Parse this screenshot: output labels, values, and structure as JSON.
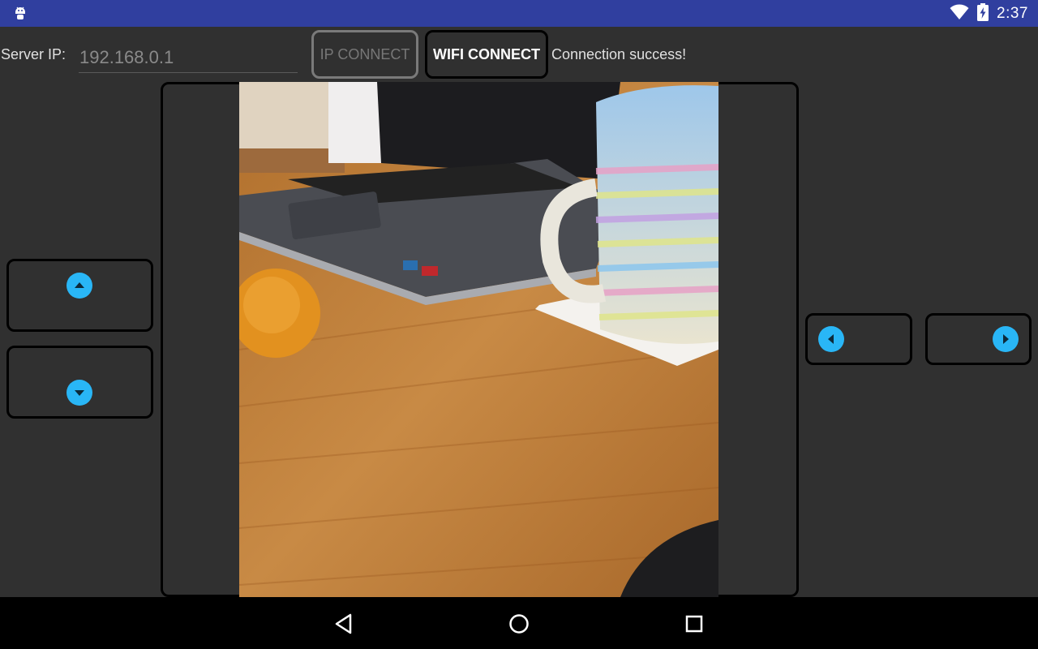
{
  "statusbar": {
    "time": "2:37",
    "icons": [
      "android-icon",
      "wifi-icon",
      "battery-charging-icon"
    ]
  },
  "form": {
    "server_label": "Server IP:",
    "ip_value": "192.168.0.1",
    "ip_connect_label": "IP CONNECT",
    "wifi_connect_label": "WIFI CONNECT",
    "connection_status": "Connection success!"
  },
  "controls": {
    "up": "arrow-up-icon",
    "down": "arrow-down-icon",
    "left": "arrow-left-icon",
    "right": "arrow-right-icon"
  },
  "navbar": {
    "icons": [
      "back-icon",
      "home-icon",
      "recents-icon"
    ]
  },
  "colors": {
    "statusbar": "#303f9f",
    "background": "#303030",
    "accent": "#29b6f6"
  }
}
